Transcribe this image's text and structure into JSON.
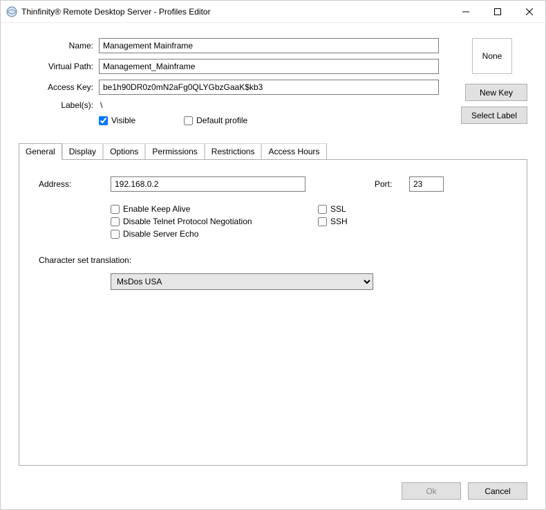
{
  "window": {
    "title": "Thinfinity® Remote Desktop Server - Profiles Editor"
  },
  "form": {
    "name_label": "Name:",
    "name_value": "Management Mainframe",
    "vpath_label": "Virtual Path:",
    "vpath_value": "Management_Mainframe",
    "akey_label": "Access Key:",
    "akey_value": "be1h90DR0z0mN2aFg0QLYGbzGaaK$kb3",
    "labels_label": "Label(s):",
    "labels_value": "\\",
    "thumb_text": "None",
    "newkey_btn": "New Key",
    "selectlabel_btn": "Select Label",
    "visible_chk": "Visible",
    "default_chk": "Default profile"
  },
  "tabs": {
    "items": [
      "General",
      "Display",
      "Options",
      "Permissions",
      "Restrictions",
      "Access Hours"
    ]
  },
  "general": {
    "address_label": "Address:",
    "address_value": "192.168.0.2",
    "port_label": "Port:",
    "port_value": "23",
    "keepalive": "Enable Keep Alive",
    "ssl": "SSL",
    "dtpn": "Disable Telnet Protocol Negotiation",
    "ssh": "SSH",
    "dse": "Disable Server Echo",
    "charset_label": "Character set translation:",
    "charset_value": "MsDos USA"
  },
  "footer": {
    "ok": "Ok",
    "cancel": "Cancel"
  }
}
